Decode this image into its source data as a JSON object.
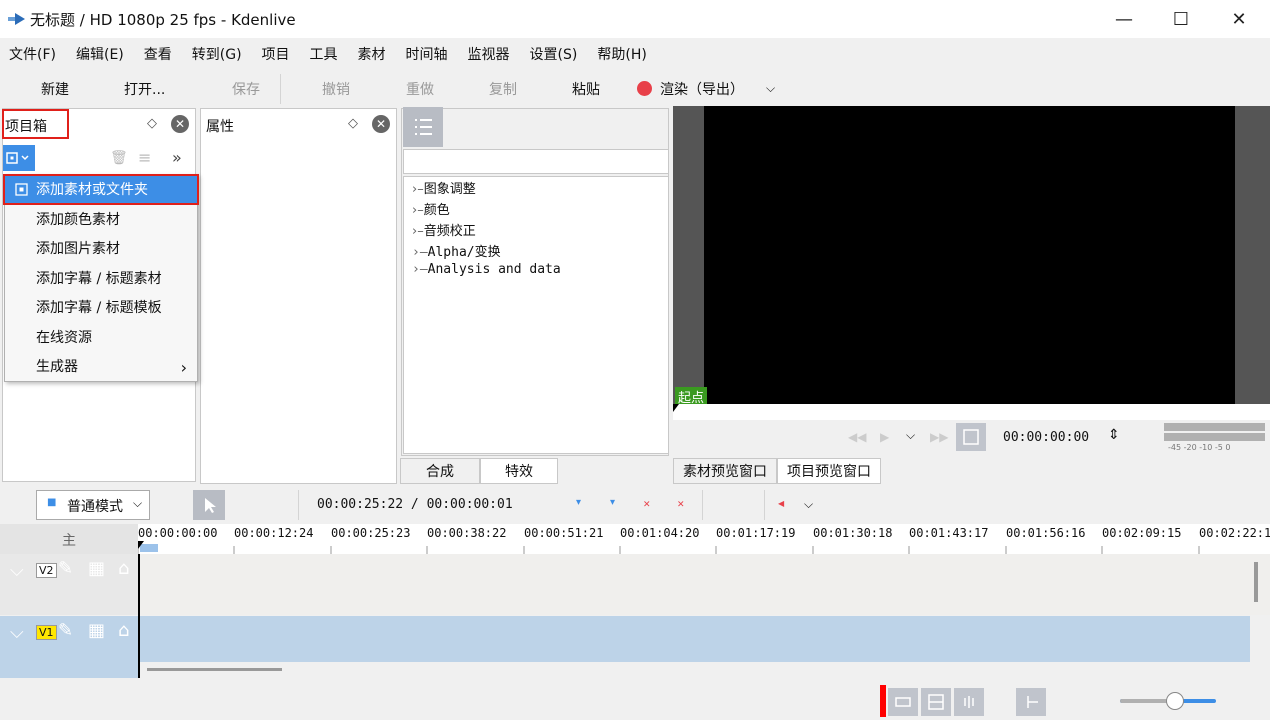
{
  "window": {
    "title": "无标题 / HD 1080p 25 fps - Kdenlive",
    "minimize": "—",
    "maximize": "☐",
    "close": "✕"
  },
  "menu": [
    "文件(F)",
    "编辑(E)",
    "查看",
    "转到(G)",
    "项目",
    "工具",
    "素材",
    "时间轴",
    "监视器",
    "设置(S)",
    "帮助(H)"
  ],
  "toolbar": {
    "new": "新建",
    "open": "打开...",
    "save": "保存",
    "undo": "撤销",
    "redo": "重做",
    "copy": "复制",
    "paste": "粘贴",
    "render": "渲染（导出）"
  },
  "bin": {
    "title": "项目箱"
  },
  "properties": {
    "title": "属性"
  },
  "add_menu": {
    "items": [
      "添加素材或文件夹",
      "添加颜色素材",
      "添加图片素材",
      "添加字幕 / 标题素材",
      "添加字幕 / 标题模板",
      "在线资源",
      "生成器"
    ],
    "submenu_arrow": "›"
  },
  "effects": {
    "tree": [
      "图象调整",
      "颜色",
      "音频校正",
      "Alpha/变换",
      "Analysis and data"
    ],
    "tabs": [
      "合成",
      "特效"
    ]
  },
  "monitor": {
    "marker": "起点",
    "timecode": "00:00:00:00",
    "meter_labels": "-45  -20  -10  -5   0",
    "tabs": [
      "素材预览窗口",
      "项目预览窗口"
    ]
  },
  "timeline": {
    "mode": "普通模式",
    "position": "00:00:25:22 / 00:00:00:01",
    "master": "主",
    "ruler": [
      "00:00:00:00",
      "00:00:12:24",
      "00:00:25:23",
      "00:00:38:22",
      "00:00:51:21",
      "00:01:04:20",
      "00:01:17:19",
      "00:01:30:18",
      "00:01:43:17",
      "00:01:56:16",
      "00:02:09:15",
      "00:02:22:1"
    ],
    "tracks": [
      "V2",
      "V1"
    ]
  },
  "colors": {
    "accent": "#3d8ee6",
    "highlight_box": "#e0201a",
    "render_dot": "#e84049",
    "marker_green": "#3a9a20",
    "v1_track": "#bdd3e8"
  }
}
